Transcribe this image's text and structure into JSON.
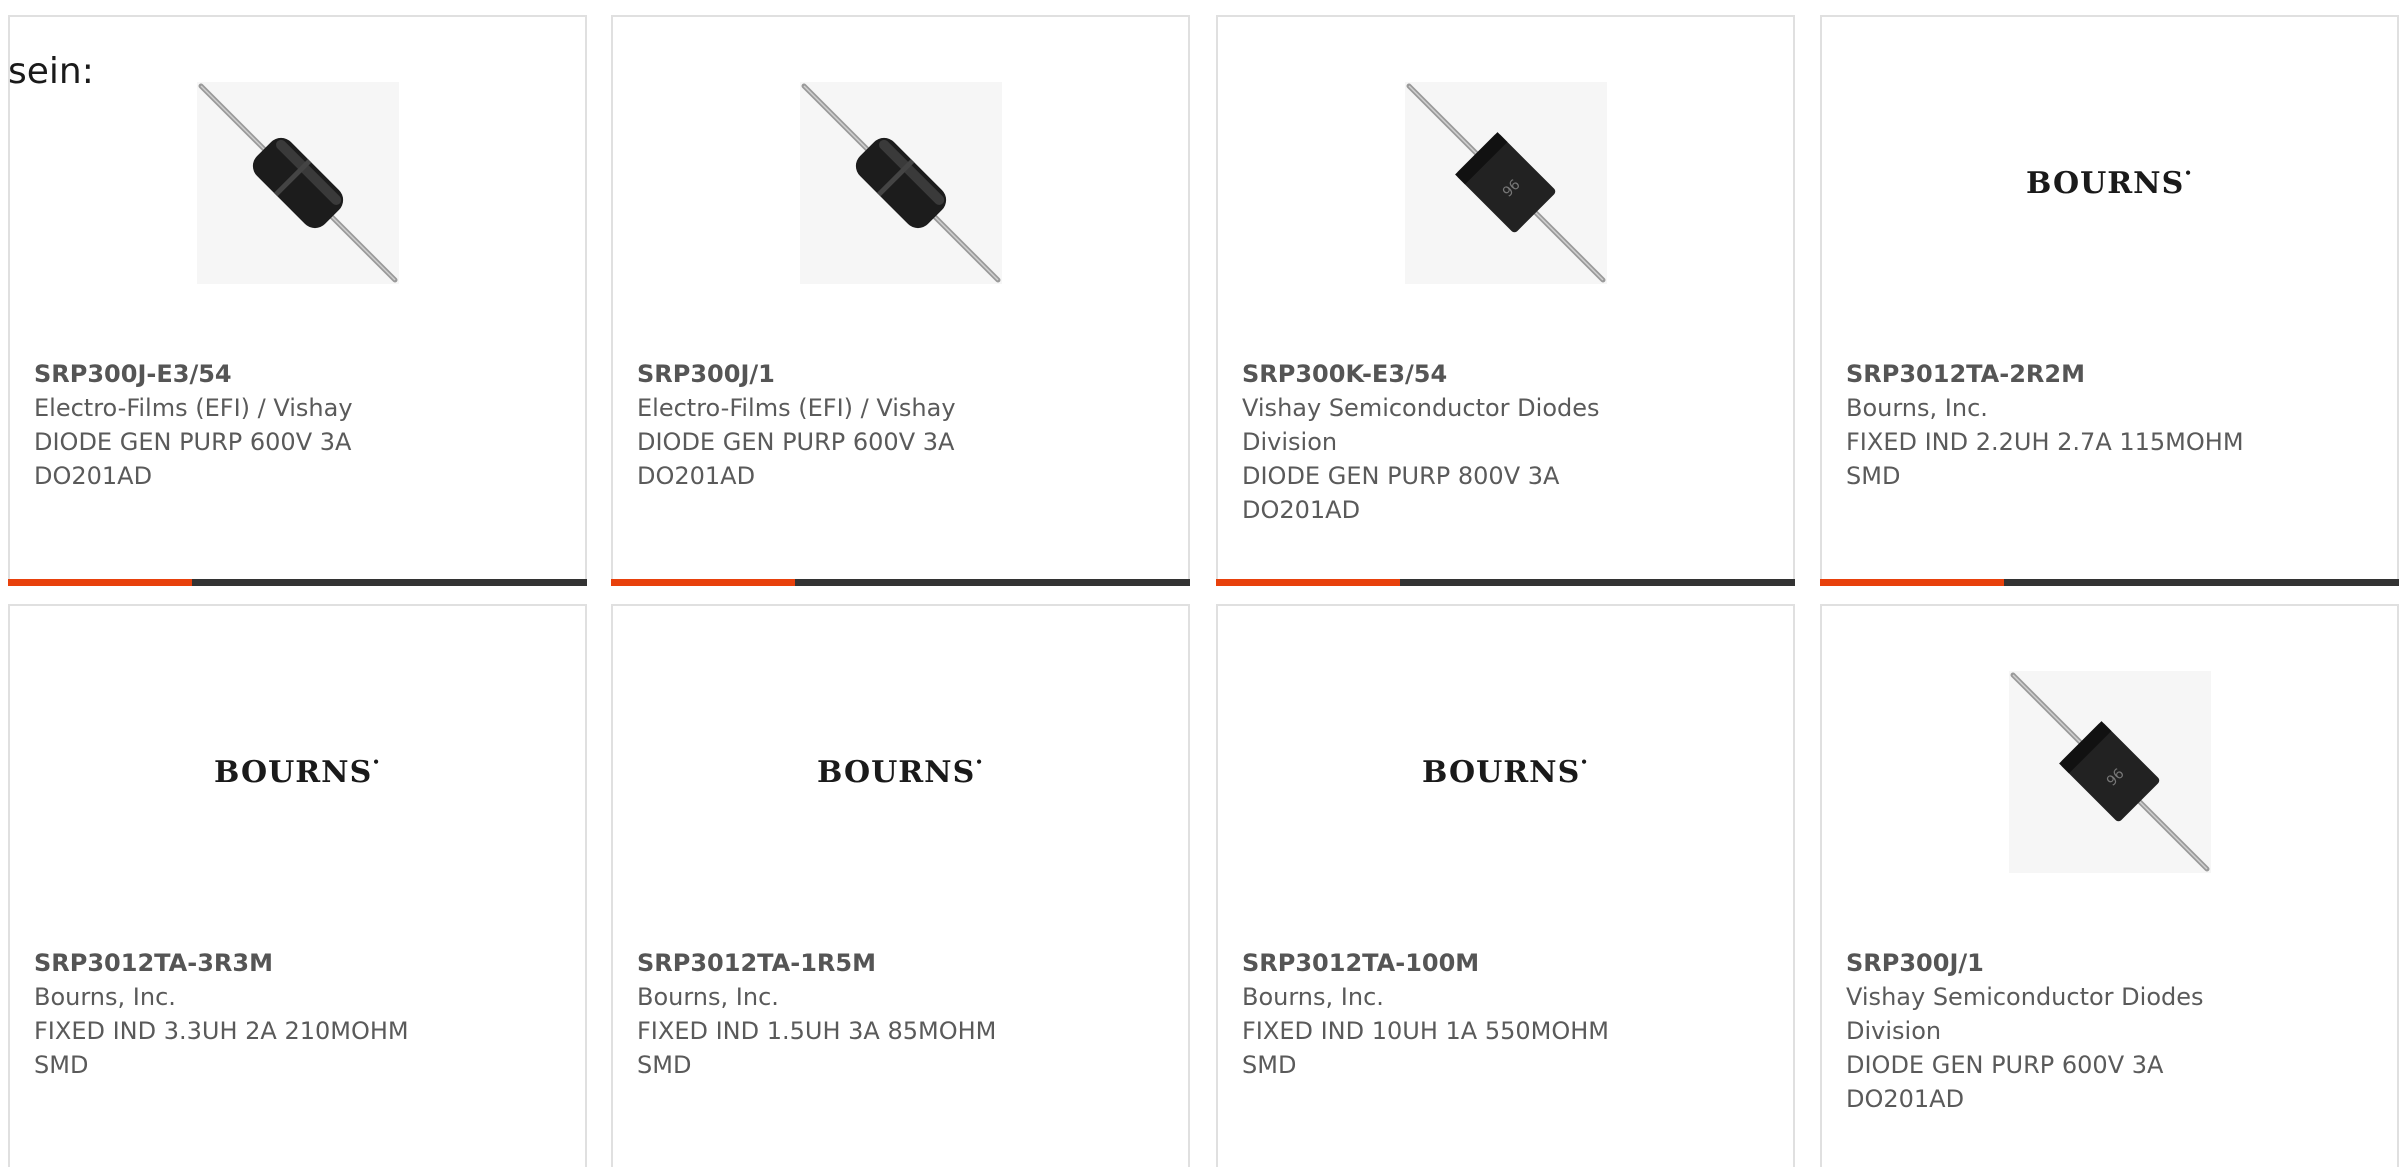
{
  "intro_text": "sein:",
  "colors": {
    "accent": "#e8410c",
    "bar": "#333333",
    "border": "#e0e0e0",
    "text": "#5a5a5a"
  },
  "cards": [
    {
      "part_number": "SRP300J-E3/54",
      "manufacturer": "Electro-Films (EFI) / Vishay",
      "description_line1": "DIODE GEN PURP 600V 3A",
      "description_line2": "DO201AD",
      "image": "diode-black-icon"
    },
    {
      "part_number": "SRP300J/1",
      "manufacturer": "Electro-Films (EFI) / Vishay",
      "description_line1": "DIODE GEN PURP 600V 3A",
      "description_line2": "DO201AD",
      "image": "diode-black-icon"
    },
    {
      "part_number": "SRP300K-E3/54",
      "manufacturer_line1": "Vishay Semiconductor Diodes",
      "manufacturer_line2": "Division",
      "description_line1": "DIODE GEN PURP 800V 3A",
      "description_line2": "DO201AD",
      "image": "diode-square-icon"
    },
    {
      "part_number": "SRP3012TA-2R2M",
      "manufacturer": "Bourns, Inc.",
      "description_line1": "FIXED IND 2.2UH 2.7A 115MOHM",
      "description_line2": "SMD",
      "image": "bourns-logo",
      "logo_text": "BOURNS"
    },
    {
      "part_number": "SRP3012TA-3R3M",
      "manufacturer": "Bourns, Inc.",
      "description_line1": "FIXED IND 3.3UH 2A 210MOHM",
      "description_line2": "SMD",
      "image": "bourns-logo",
      "logo_text": "BOURNS"
    },
    {
      "part_number": "SRP3012TA-1R5M",
      "manufacturer": "Bourns, Inc.",
      "description_line1": "FIXED IND 1.5UH 3A 85MOHM",
      "description_line2": "SMD",
      "image": "bourns-logo",
      "logo_text": "BOURNS"
    },
    {
      "part_number": "SRP3012TA-100M",
      "manufacturer": "Bourns, Inc.",
      "description_line1": "FIXED IND 10UH 1A 550MOHM",
      "description_line2": "SMD",
      "image": "bourns-logo",
      "logo_text": "BOURNS"
    },
    {
      "part_number": "SRP300J/1",
      "manufacturer_line1": "Vishay Semiconductor Diodes",
      "manufacturer_line2": "Division",
      "description_line1": "DIODE GEN PURP 600V 3A",
      "description_line2": "DO201AD",
      "image": "diode-square-icon"
    }
  ]
}
